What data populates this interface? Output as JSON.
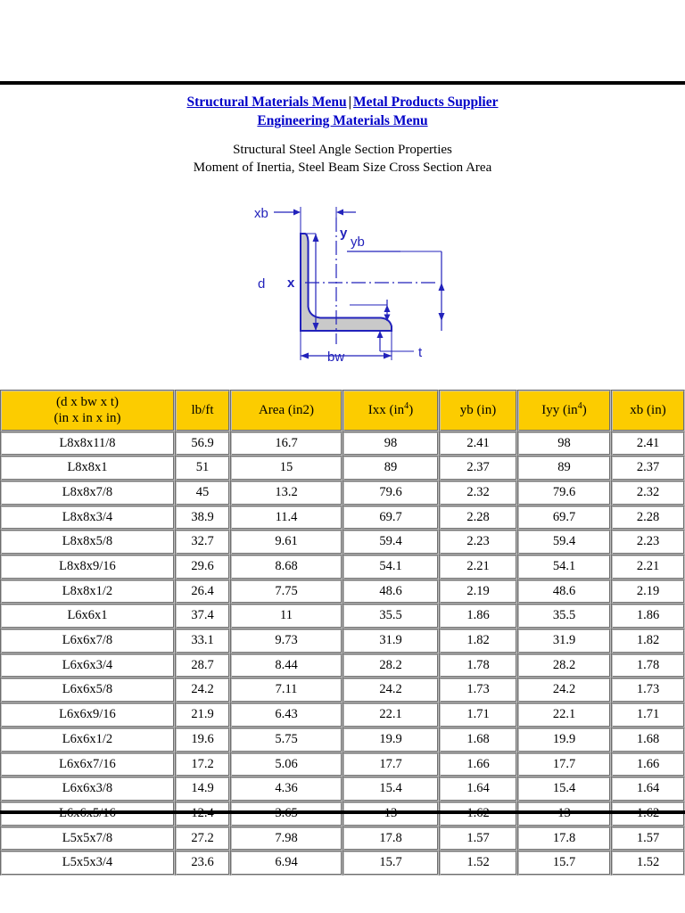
{
  "nav": {
    "links": [
      {
        "label": "Structural Materials Menu"
      },
      {
        "label": "Metal Products Supplier"
      },
      {
        "label": "Engineering Materials Menu"
      }
    ],
    "separator": "|",
    "link_color": "#0000c8"
  },
  "subtitle": {
    "line1": "Structural Steel Angle Section Properties",
    "line2": "Moment of Inertia, Steel Beam Size Cross Section Area"
  },
  "diagram": {
    "name": "steel-angle-cross-section",
    "stroke_color": "#2222bb",
    "fill_color": "#c8c8c8",
    "labels": {
      "xb": "xb",
      "y": "y",
      "yb": "yb",
      "x": "x",
      "d": "d",
      "bw": "bw",
      "t": "t"
    }
  },
  "table": {
    "header_color": "#fccc00",
    "columns": [
      {
        "line1": "(d x bw x t)",
        "line2": "(in x in x in)",
        "sup": ""
      },
      {
        "line1": "lb/ft",
        "line2": "",
        "sup": ""
      },
      {
        "line1": "Area (in2)",
        "line2": "",
        "sup": ""
      },
      {
        "line1": "Ixx (in",
        "line2": ")",
        "sup": "4"
      },
      {
        "line1": "yb (in)",
        "line2": "",
        "sup": ""
      },
      {
        "line1": "Iyy (in",
        "line2": ")",
        "sup": "4"
      },
      {
        "line1": "xb (in)",
        "line2": "",
        "sup": ""
      }
    ],
    "rows": [
      [
        "L8x8x11/8",
        "56.9",
        "16.7",
        "98",
        "2.41",
        "98",
        "2.41"
      ],
      [
        "L8x8x1",
        "51",
        "15",
        "89",
        "2.37",
        "89",
        "2.37"
      ],
      [
        "L8x8x7/8",
        "45",
        "13.2",
        "79.6",
        "2.32",
        "79.6",
        "2.32"
      ],
      [
        "L8x8x3/4",
        "38.9",
        "11.4",
        "69.7",
        "2.28",
        "69.7",
        "2.28"
      ],
      [
        "L8x8x5/8",
        "32.7",
        "9.61",
        "59.4",
        "2.23",
        "59.4",
        "2.23"
      ],
      [
        "L8x8x9/16",
        "29.6",
        "8.68",
        "54.1",
        "2.21",
        "54.1",
        "2.21"
      ],
      [
        "L8x8x1/2",
        "26.4",
        "7.75",
        "48.6",
        "2.19",
        "48.6",
        "2.19"
      ],
      [
        "L6x6x1",
        "37.4",
        "11",
        "35.5",
        "1.86",
        "35.5",
        "1.86"
      ],
      [
        "L6x6x7/8",
        "33.1",
        "9.73",
        "31.9",
        "1.82",
        "31.9",
        "1.82"
      ],
      [
        "L6x6x3/4",
        "28.7",
        "8.44",
        "28.2",
        "1.78",
        "28.2",
        "1.78"
      ],
      [
        "L6x6x5/8",
        "24.2",
        "7.11",
        "24.2",
        "1.73",
        "24.2",
        "1.73"
      ],
      [
        "L6x6x9/16",
        "21.9",
        "6.43",
        "22.1",
        "1.71",
        "22.1",
        "1.71"
      ],
      [
        "L6x6x1/2",
        "19.6",
        "5.75",
        "19.9",
        "1.68",
        "19.9",
        "1.68"
      ],
      [
        "L6x6x7/16",
        "17.2",
        "5.06",
        "17.7",
        "1.66",
        "17.7",
        "1.66"
      ],
      [
        "L6x6x3/8",
        "14.9",
        "4.36",
        "15.4",
        "1.64",
        "15.4",
        "1.64"
      ],
      [
        "L6x6x5/16",
        "12.4",
        "3.65",
        "13",
        "1.62",
        "13",
        "1.62"
      ],
      [
        "L5x5x7/8",
        "27.2",
        "7.98",
        "17.8",
        "1.57",
        "17.8",
        "1.57"
      ],
      [
        "L5x5x3/4",
        "23.6",
        "6.94",
        "15.7",
        "1.52",
        "15.7",
        "1.52"
      ]
    ]
  }
}
